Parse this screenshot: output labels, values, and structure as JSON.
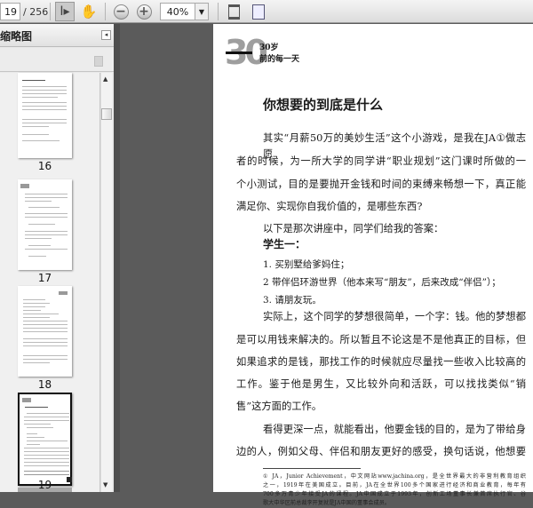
{
  "toolbar": {
    "page_current": "19",
    "page_total": "/ 256",
    "zoom": "40%",
    "icons": [
      "select-tool-icon",
      "hand-tool-icon",
      "zoom-out-icon",
      "zoom-in-icon",
      "dropdown-icon",
      "fit-width-icon",
      "fit-page-icon"
    ]
  },
  "panel": {
    "title": "缩略图",
    "collapse_icon": "collapse-left-icon",
    "trash_icon": "trash-icon"
  },
  "thumbnails": [
    {
      "label": "16"
    },
    {
      "label": "17"
    },
    {
      "label": "18"
    },
    {
      "label": "19",
      "selected": true
    }
  ],
  "page": {
    "header_number": "30",
    "header_line1": "30岁",
    "header_line2": "前的每一天",
    "title": "你想要的到底是什么",
    "lines": [
      "其实“月薪50万的美妙生活”这个小游戏，是我在JA①做志愿",
      "者的时候，为一所大学的同学讲“职业规划”这门课时所做的一",
      "个小测试，目的是要抛开金钱和时间的束缚来畅想一下，真正能",
      "满足你、实现你自我价值的，是哪些东西?",
      "以下是那次讲座中，同学们给我的答案："
    ],
    "student_heading": "学生一：",
    "list": [
      "1.  买别墅给爹妈住；",
      "2  带伴侣环游世界（他本来写“朋友”，后来改成“伴侣”）；",
      "3.  请朋友玩。"
    ],
    "lines2": [
      "实际上，这个同学的梦想很简单，一个字：钱。他的梦想都",
      "是可以用钱来解决的。所以暂且不论这是不是他真正的目标，但",
      "如果追求的是钱，那找工作的时候就应尽量找一些收入比较高的",
      "工作。鉴于他是男生，又比较外向和活跃，可以找找类似“销",
      "售”这方面的工作。",
      "看得更深一点，就能看出，他要金钱的目的，是为了带给身",
      "边的人，例如父母、伴侣和朋友更好的感受，换句话说，他想要"
    ],
    "footnote": [
      "① JA，Junior Achievement，中文网站www.jachina.org，是全世界最大的非营利教育组织",
      "之一，1919年在美国成立。目前，JA在全世界100多个国家进行经济和商业教育，每年有",
      "700多万青少年接受JA的课程。JA中国成立于1993年，创新工场董事长兼首席执行官、谷",
      "歌大中华区前总裁李开复就是JA中国的董事会成员。"
    ]
  }
}
